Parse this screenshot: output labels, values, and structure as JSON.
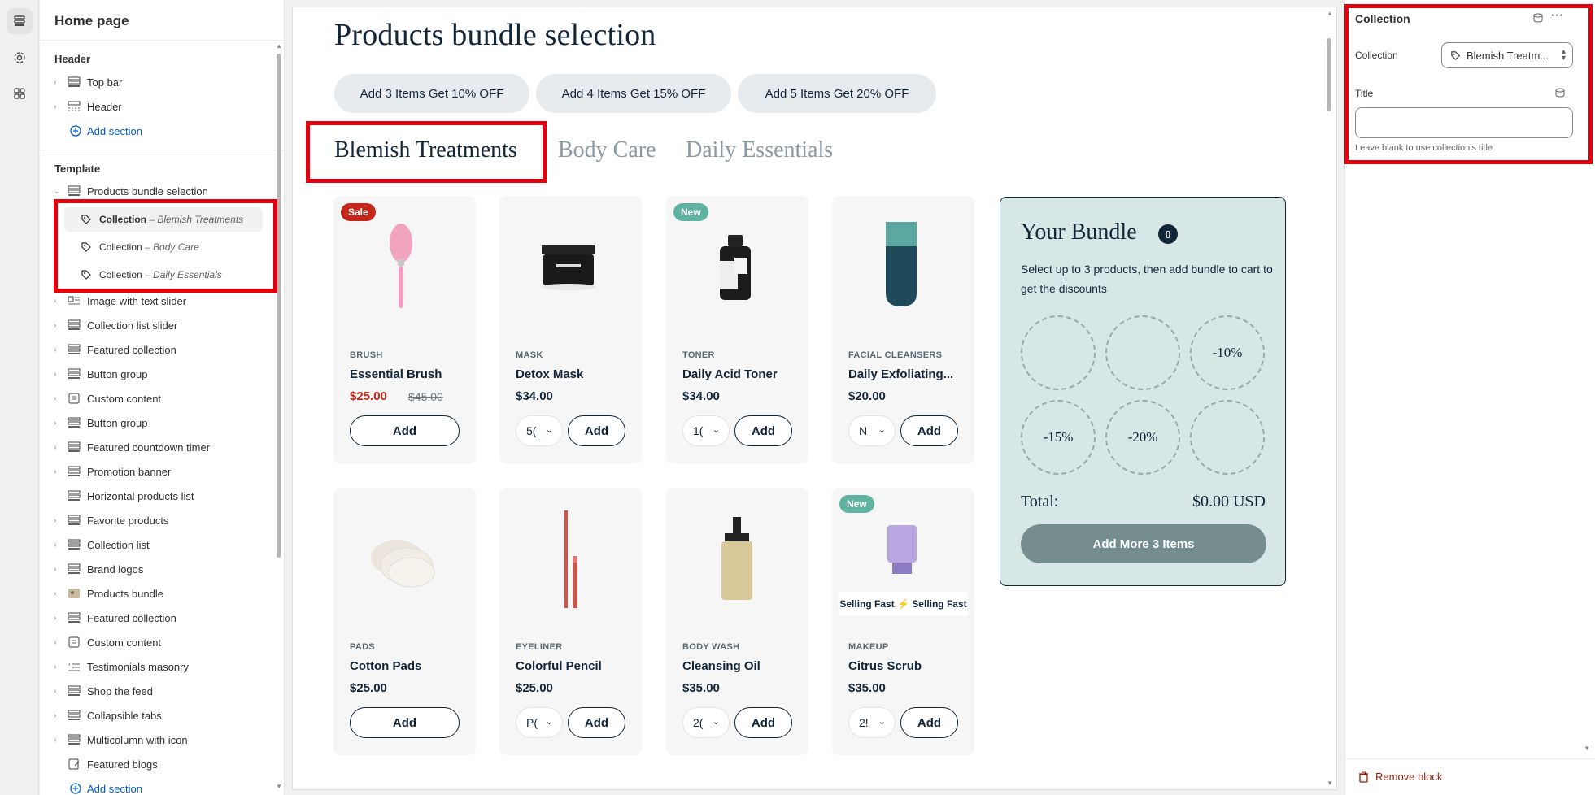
{
  "sidebar": {
    "title": "Home page",
    "header_group": "Header",
    "header_items": [
      {
        "label": "Top bar"
      },
      {
        "label": "Header"
      }
    ],
    "add_section": "Add section",
    "template_group": "Template",
    "expanded_section": "Products bundle selection",
    "blocks": [
      {
        "type": "Collection",
        "name": "– Blemish Treatments"
      },
      {
        "type": "Collection",
        "name": "– Body Care"
      },
      {
        "type": "Collection",
        "name": "– Daily Essentials"
      }
    ],
    "sections": [
      "Image with text slider",
      "Collection list slider",
      "Featured collection",
      "Button group",
      "Custom content",
      "Button group",
      "Featured countdown timer",
      "Promotion banner",
      "Horizontal products list",
      "Favorite products",
      "Collection list",
      "Brand logos",
      "Products bundle",
      "Featured collection",
      "Custom content",
      "Testimonials masonry",
      "Shop the feed",
      "Collapsible tabs",
      "Multicolumn with icon",
      "Featured blogs"
    ],
    "add_section_bottom": "Add section"
  },
  "preview": {
    "title": "Products bundle selection",
    "offers": [
      "Add 3 Items Get 10% OFF",
      "Add 4 Items Get 15% OFF",
      "Add 5 Items Get 20% OFF"
    ],
    "tabs": [
      "Blemish Treatments",
      "Body Care",
      "Daily Essentials"
    ],
    "products": [
      {
        "badge": "Sale",
        "category": "BRUSH",
        "name": "Essential Brush",
        "price": "$25.00",
        "compare": "$45.00",
        "variant": "",
        "add": "Add"
      },
      {
        "badge": "",
        "category": "MASK",
        "name": "Detox Mask",
        "price": "$34.00",
        "compare": "",
        "variant": "5(",
        "add": "Add"
      },
      {
        "badge": "New",
        "category": "TONER",
        "name": "Daily Acid Toner",
        "price": "$34.00",
        "compare": "",
        "variant": "1(",
        "add": "Add"
      },
      {
        "badge": "",
        "category": "FACIAL CLEANSERS",
        "name": "Daily Exfoliating...",
        "price": "$20.00",
        "compare": "",
        "variant": "N",
        "add": "Add"
      },
      {
        "badge": "",
        "category": "PADS",
        "name": "Cotton Pads",
        "price": "$25.00",
        "compare": "",
        "variant": "",
        "add": "Add"
      },
      {
        "badge": "",
        "category": "EYELINER",
        "name": "Colorful Pencil",
        "price": "$25.00",
        "compare": "",
        "variant": "P(",
        "add": "Add"
      },
      {
        "badge": "",
        "category": "BODY WASH",
        "name": "Cleansing Oil",
        "price": "$35.00",
        "compare": "",
        "variant": "2(",
        "add": "Add"
      },
      {
        "badge": "New",
        "category": "MAKEUP",
        "name": "Citrus Scrub",
        "price": "$35.00",
        "compare": "",
        "variant": "2!",
        "add": "Add",
        "marquee": "Selling Fast ⚡ Selling Fast"
      }
    ],
    "bundle": {
      "title": "Your Bundle",
      "count": "0",
      "description": "Select up to 3 products, then add bundle to cart to get the discounts",
      "slots": [
        "",
        "",
        "-10%",
        "-15%",
        "-20%",
        ""
      ],
      "total_label": "Total:",
      "total_value": "$0.00 USD",
      "cta": "Add More 3 Items"
    }
  },
  "settings": {
    "title": "Collection",
    "collection_label": "Collection",
    "collection_value": "Blemish Treatm...",
    "title_label": "Title",
    "title_value": "",
    "help": "Leave blank to use collection's title",
    "remove": "Remove block"
  },
  "colors": {
    "accent_red": "#e3000f",
    "navy": "#12263a",
    "sale": "#c4261a",
    "new_badge": "#5fb3a1",
    "bundle_bg": "#d6e7e6"
  }
}
